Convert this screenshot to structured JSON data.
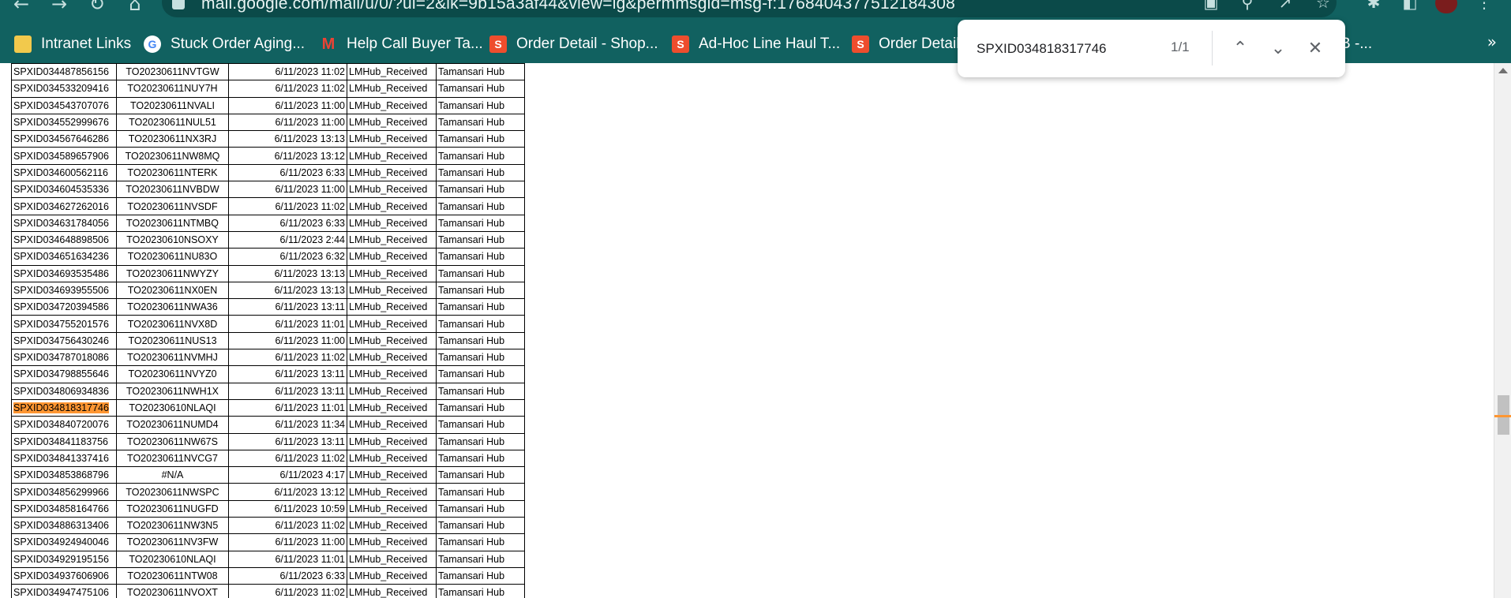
{
  "browser": {
    "url": "mail.google.com/mail/u/0/?ui=2&ik=9b15a3af44&view=lg&permmsgid=msg-f:1768404377512184308"
  },
  "bookmarks": [
    {
      "label": "Intranet Links",
      "icon": "folder-icon"
    },
    {
      "label": "Stuck Order Aging...",
      "icon": "google-icon"
    },
    {
      "label": "Help Call Buyer Ta...",
      "icon": "gmail-icon"
    },
    {
      "label": "Order Detail - Shop...",
      "icon": "shopee-icon"
    },
    {
      "label": "Ad-Hoc Line Haul T...",
      "icon": "shopee-icon"
    },
    {
      "label": "Order Detail",
      "icon": "shopee-icon"
    },
    {
      "label": "B -...",
      "icon": ""
    }
  ],
  "find": {
    "query": "SPXID034818317746",
    "count": "1/1"
  },
  "colors": {
    "chrome_bg": "#116160",
    "highlight": "#ff9632"
  },
  "table": {
    "rows": [
      [
        "SPXID034487856156",
        "TO20230611NVTGW",
        "6/11/2023 11:02",
        "LMHub_Received",
        "Tamansari Hub"
      ],
      [
        "SPXID034533209416",
        "TO20230611NUY7H",
        "6/11/2023 11:02",
        "LMHub_Received",
        "Tamansari Hub"
      ],
      [
        "SPXID034543707076",
        "TO20230611NVALI",
        "6/11/2023 11:00",
        "LMHub_Received",
        "Tamansari Hub"
      ],
      [
        "SPXID034552999676",
        "TO20230611NUL51",
        "6/11/2023 11:00",
        "LMHub_Received",
        "Tamansari Hub"
      ],
      [
        "SPXID034567646286",
        "TO20230611NX3RJ",
        "6/11/2023 13:13",
        "LMHub_Received",
        "Tamansari Hub"
      ],
      [
        "SPXID034589657906",
        "TO20230611NW8MQ",
        "6/11/2023 13:12",
        "LMHub_Received",
        "Tamansari Hub"
      ],
      [
        "SPXID034600562116",
        "TO20230611NTERK",
        "6/11/2023 6:33",
        "LMHub_Received",
        "Tamansari Hub"
      ],
      [
        "SPXID034604535336",
        "TO20230611NVBDW",
        "6/11/2023 11:00",
        "LMHub_Received",
        "Tamansari Hub"
      ],
      [
        "SPXID034627262016",
        "TO20230611NVSDF",
        "6/11/2023 11:02",
        "LMHub_Received",
        "Tamansari Hub"
      ],
      [
        "SPXID034631784056",
        "TO20230611NTMBQ",
        "6/11/2023 6:33",
        "LMHub_Received",
        "Tamansari Hub"
      ],
      [
        "SPXID034648898506",
        "TO20230610NSOXY",
        "6/11/2023 2:44",
        "LMHub_Received",
        "Tamansari Hub"
      ],
      [
        "SPXID034651634236",
        "TO20230611NU83O",
        "6/11/2023 6:32",
        "LMHub_Received",
        "Tamansari Hub"
      ],
      [
        "SPXID034693535486",
        "TO20230611NWYZY",
        "6/11/2023 13:13",
        "LMHub_Received",
        "Tamansari Hub"
      ],
      [
        "SPXID034693955506",
        "TO20230611NX0EN",
        "6/11/2023 13:13",
        "LMHub_Received",
        "Tamansari Hub"
      ],
      [
        "SPXID034720394586",
        "TO20230611NWA36",
        "6/11/2023 13:11",
        "LMHub_Received",
        "Tamansari Hub"
      ],
      [
        "SPXID034755201576",
        "TO20230611NVX8D",
        "6/11/2023 11:01",
        "LMHub_Received",
        "Tamansari Hub"
      ],
      [
        "SPXID034756430246",
        "TO20230611NUS13",
        "6/11/2023 11:00",
        "LMHub_Received",
        "Tamansari Hub"
      ],
      [
        "SPXID034787018086",
        "TO20230611NVMHJ",
        "6/11/2023 11:02",
        "LMHub_Received",
        "Tamansari Hub"
      ],
      [
        "SPXID034798855646",
        "TO20230611NVYZ0",
        "6/11/2023 13:11",
        "LMHub_Received",
        "Tamansari Hub"
      ],
      [
        "SPXID034806934836",
        "TO20230611NWH1X",
        "6/11/2023 13:11",
        "LMHub_Received",
        "Tamansari Hub"
      ],
      [
        "SPXID034818317746",
        "TO20230610NLAQI",
        "6/11/2023 11:01",
        "LMHub_Received",
        "Tamansari Hub"
      ],
      [
        "SPXID034840720076",
        "TO20230611NUMD4",
        "6/11/2023 11:34",
        "LMHub_Received",
        "Tamansari Hub"
      ],
      [
        "SPXID034841183756",
        "TO20230611NW67S",
        "6/11/2023 13:11",
        "LMHub_Received",
        "Tamansari Hub"
      ],
      [
        "SPXID034841337416",
        "TO20230611NVCG7",
        "6/11/2023 11:02",
        "LMHub_Received",
        "Tamansari Hub"
      ],
      [
        "SPXID034853868796",
        "#N/A",
        "6/11/2023 4:17",
        "LMHub_Received",
        "Tamansari Hub"
      ],
      [
        "SPXID034856299966",
        "TO20230611NWSPC",
        "6/11/2023 13:12",
        "LMHub_Received",
        "Tamansari Hub"
      ],
      [
        "SPXID034858164766",
        "TO20230611NUGFD",
        "6/11/2023 10:59",
        "LMHub_Received",
        "Tamansari Hub"
      ],
      [
        "SPXID034886313406",
        "TO20230611NW3N5",
        "6/11/2023 11:02",
        "LMHub_Received",
        "Tamansari Hub"
      ],
      [
        "SPXID034924940046",
        "TO20230611NV3FW",
        "6/11/2023 11:00",
        "LMHub_Received",
        "Tamansari Hub"
      ],
      [
        "SPXID034929195156",
        "TO20230610NLAQI",
        "6/11/2023 11:01",
        "LMHub_Received",
        "Tamansari Hub"
      ],
      [
        "SPXID034937606906",
        "TO20230611NTW08",
        "6/11/2023 6:33",
        "LMHub_Received",
        "Tamansari Hub"
      ],
      [
        "SPXID034947475106",
        "TO20230611NVOXT",
        "6/11/2023 11:02",
        "LMHub_Received",
        "Tamansari Hub"
      ]
    ]
  }
}
